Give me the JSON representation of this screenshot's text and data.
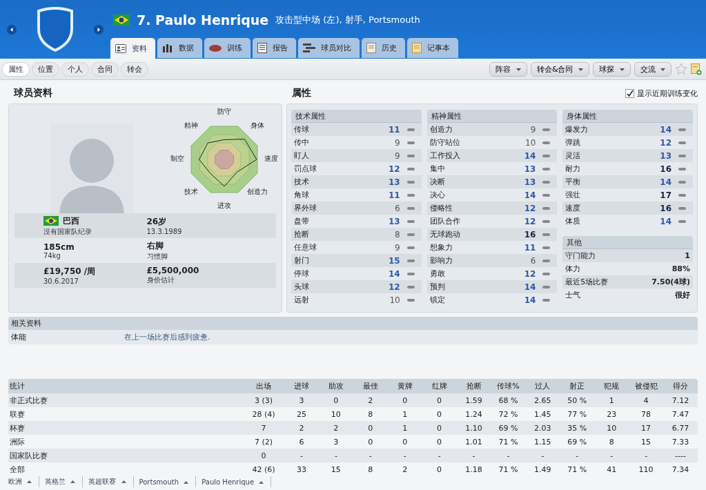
{
  "header": {
    "title": "7. Paulo Henrique",
    "subtitle": "攻击型中场 (左), 射手, Portsmouth"
  },
  "tabs": [
    {
      "label": "资料",
      "selected": true
    },
    {
      "label": "数据",
      "selected": false
    },
    {
      "label": "训练",
      "selected": false
    },
    {
      "label": "报告",
      "selected": false
    },
    {
      "label": "球员对比",
      "selected": false
    },
    {
      "label": "历史",
      "selected": false
    },
    {
      "label": "记事本",
      "selected": false
    }
  ],
  "subtabs": [
    {
      "label": "属性",
      "selected": true
    },
    {
      "label": "位置",
      "selected": false
    },
    {
      "label": "个人",
      "selected": false
    },
    {
      "label": "合同",
      "selected": false
    },
    {
      "label": "转会",
      "selected": false
    }
  ],
  "menus": [
    "阵容",
    "转会&合同",
    "球探",
    "交流"
  ],
  "profile": {
    "title": "球员资料",
    "radar_labels": [
      "防守",
      "身体",
      "速度",
      "创造力",
      "进攻",
      "技术",
      "制空",
      "精神"
    ],
    "nationality": {
      "value": "巴西",
      "caption": "没有国家队纪录"
    },
    "facts": [
      {
        "value": "26岁",
        "caption": "13.3.1989"
      },
      {
        "value": "185cm",
        "caption": "74kg"
      },
      {
        "value": "右脚",
        "caption": "习惯脚"
      },
      {
        "value": "£19,750 /周",
        "caption": "30.6.2017"
      },
      {
        "value": "£5,500,000",
        "caption": "身价估计"
      }
    ]
  },
  "attributes": {
    "title": "属性",
    "toggle": {
      "label": "显示近期训练变化",
      "checked": true
    },
    "groups": [
      {
        "title": "技术属性",
        "rows": [
          {
            "name": "传球",
            "value": "11"
          },
          {
            "name": "传中",
            "value": "9"
          },
          {
            "name": "盯人",
            "value": "9"
          },
          {
            "name": "罚点球",
            "value": "12"
          },
          {
            "name": "技术",
            "value": "13"
          },
          {
            "name": "角球",
            "value": "11"
          },
          {
            "name": "界外球",
            "value": "6"
          },
          {
            "name": "盘带",
            "value": "13"
          },
          {
            "name": "抢断",
            "value": "8"
          },
          {
            "name": "任意球",
            "value": "9"
          },
          {
            "name": "射门",
            "value": "15"
          },
          {
            "name": "停球",
            "value": "14"
          },
          {
            "name": "头球",
            "value": "12"
          },
          {
            "name": "远射",
            "value": "10"
          }
        ]
      },
      {
        "title": "精神属性",
        "rows": [
          {
            "name": "创造力",
            "value": "9"
          },
          {
            "name": "防守站位",
            "value": "10"
          },
          {
            "name": "工作投入",
            "value": "14"
          },
          {
            "name": "集中",
            "value": "13"
          },
          {
            "name": "决断",
            "value": "13"
          },
          {
            "name": "决心",
            "value": "14"
          },
          {
            "name": "侵略性",
            "value": "12"
          },
          {
            "name": "团队合作",
            "value": "12"
          },
          {
            "name": "无球跑动",
            "value": "16"
          },
          {
            "name": "想象力",
            "value": "11"
          },
          {
            "name": "影响力",
            "value": "6"
          },
          {
            "name": "勇敢",
            "value": "12"
          },
          {
            "name": "预判",
            "value": "14"
          },
          {
            "name": "镇定",
            "value": "14"
          }
        ]
      },
      {
        "title": "身体属性",
        "rows": [
          {
            "name": "爆发力",
            "value": "14"
          },
          {
            "name": "弹跳",
            "value": "12"
          },
          {
            "name": "灵活",
            "value": "13"
          },
          {
            "name": "耐力",
            "value": "16"
          },
          {
            "name": "平衡",
            "value": "14"
          },
          {
            "name": "强壮",
            "value": "17"
          },
          {
            "name": "速度",
            "value": "16"
          },
          {
            "name": "体质",
            "value": "14"
          }
        ]
      }
    ],
    "other": {
      "title": "其他",
      "rows": [
        {
          "name": "守门能力",
          "value": "1"
        },
        {
          "name": "体力",
          "value": "88%"
        },
        {
          "name": "最近5场比赛",
          "value": "7.50(4球)"
        },
        {
          "name": "士气",
          "value": "很好"
        }
      ]
    }
  },
  "related": {
    "title": "相关资料",
    "rows": [
      {
        "label": "体能",
        "value": "在上一场比赛后感到疲惫."
      }
    ]
  },
  "stats": {
    "columns": [
      "统计",
      "出场",
      "进球",
      "助攻",
      "最佳",
      "黄牌",
      "红牌",
      "抢断",
      "传球%",
      "过人",
      "射正",
      "犯规",
      "被侵犯",
      "得分"
    ],
    "rows": [
      [
        "非正式比赛",
        "3 (3)",
        "3",
        "0",
        "2",
        "0",
        "0",
        "1.59",
        "68 %",
        "2.65",
        "50 %",
        "1",
        "4",
        "7.12"
      ],
      [
        "联赛",
        "28 (4)",
        "25",
        "10",
        "8",
        "1",
        "0",
        "1.24",
        "72 %",
        "1.45",
        "77 %",
        "23",
        "78",
        "7.47"
      ],
      [
        "杯赛",
        "7",
        "2",
        "2",
        "0",
        "1",
        "0",
        "1.10",
        "69 %",
        "2.03",
        "35 %",
        "10",
        "17",
        "6.77"
      ],
      [
        "洲际",
        "7 (2)",
        "6",
        "3",
        "0",
        "0",
        "0",
        "1.01",
        "71 %",
        "1.15",
        "69 %",
        "8",
        "15",
        "7.33"
      ],
      [
        "国家队比赛",
        "0",
        "-",
        "-",
        "-",
        "-",
        "-",
        "-",
        "-",
        "-",
        "-",
        "-",
        "-",
        "----"
      ],
      [
        "全部",
        "42 (6)",
        "33",
        "15",
        "8",
        "2",
        "0",
        "1.18",
        "71 %",
        "1.49",
        "71 %",
        "41",
        "110",
        "7.34"
      ]
    ]
  },
  "breadcrumb": [
    "欧洲",
    "英格兰",
    "英超联赛",
    "Portsmouth",
    "Paulo Henrique"
  ]
}
